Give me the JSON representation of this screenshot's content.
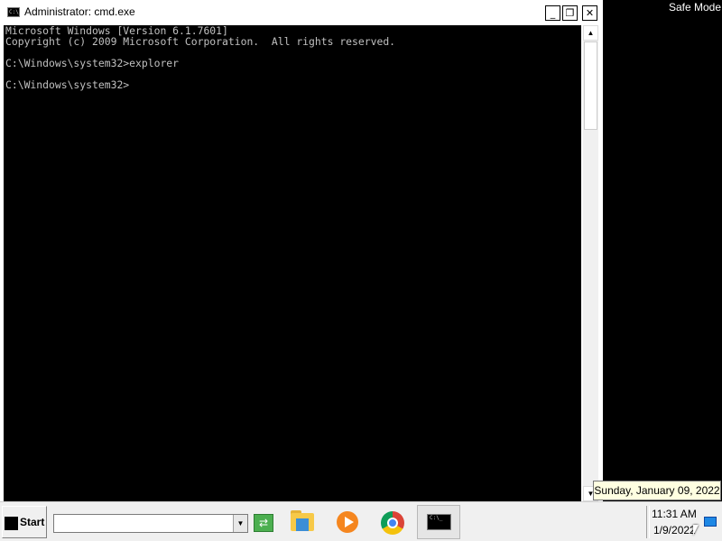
{
  "desktop": {
    "safe_mode_label": "Safe Mode"
  },
  "window": {
    "title": "Administrator: cmd.exe",
    "icon_text": "C:\\",
    "controls": {
      "minimize": "_",
      "maximize": "❐",
      "close": "✕"
    }
  },
  "console": {
    "lines": [
      "Microsoft Windows [Version 6.1.7601]",
      "Copyright (c) 2009 Microsoft Corporation.  All rights reserved.",
      "",
      "C:\\Windows\\system32>explorer",
      "",
      "C:\\Windows\\system32>"
    ]
  },
  "scrollbar": {
    "up_arrow": "▲",
    "down_arrow": "▼"
  },
  "tooltip": {
    "text": "Sunday, January 09, 2022"
  },
  "taskbar": {
    "start_label": "Start",
    "address_value": "",
    "dropdown_arrow": "▼",
    "go_glyph": "⇄",
    "apps": [
      "folder-icon",
      "media-player-icon",
      "chrome-icon",
      "cmd-icon"
    ],
    "cmd_icon_text": "C:\\_",
    "clock": {
      "time": "11:31 AM",
      "date": "1/9/2022"
    }
  },
  "colors": {
    "console_bg": "#000000",
    "console_fg": "#c0c0c0",
    "tooltip_bg": "#ffffe1",
    "taskbar_bg": "#f0f0f0"
  }
}
